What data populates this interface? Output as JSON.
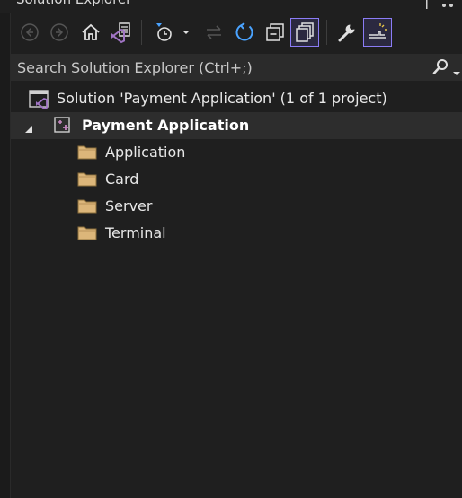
{
  "window": {
    "title": "Solution Explorer",
    "controls": [
      "pin-icon",
      "more-icon"
    ]
  },
  "toolbar": {
    "buttons": [
      {
        "name": "back-button",
        "icon": "back-arrow-icon",
        "enabled": false
      },
      {
        "name": "forward-button",
        "icon": "forward-arrow-icon",
        "enabled": false
      },
      {
        "name": "home-button",
        "icon": "home-icon",
        "enabled": true
      },
      {
        "name": "switch-views-button",
        "icon": "vs-solution-view-icon",
        "enabled": true
      },
      {
        "name": "pending-changes-filter-button",
        "icon": "clock-filter-icon",
        "enabled": true,
        "has_dropdown": true
      },
      {
        "name": "sync-with-active-document-button",
        "icon": "sync-arrows-icon",
        "enabled": false
      },
      {
        "name": "refresh-button",
        "icon": "refresh-icon",
        "enabled": true
      },
      {
        "name": "collapse-all-button",
        "icon": "collapse-all-icon",
        "enabled": true
      },
      {
        "name": "show-all-files-button",
        "icon": "show-all-files-icon",
        "enabled": true,
        "active": true
      },
      {
        "name": "properties-button",
        "icon": "wrench-icon",
        "enabled": true
      },
      {
        "name": "preview-selected-items-button",
        "icon": "preview-icon",
        "enabled": true,
        "active": true
      }
    ],
    "accent": "#8b7cf6"
  },
  "search": {
    "placeholder": "Search Solution Explorer (Ctrl+;)",
    "icon": "search-icon"
  },
  "tree": {
    "solution": {
      "label": "Solution 'Payment Application' (1 of 1 project)",
      "icon": "solution-icon"
    },
    "project": {
      "label": "Payment Application",
      "icon": "cpp-project-icon",
      "expanded": true,
      "selected": true
    },
    "folders": [
      {
        "label": "Application",
        "icon": "folder-icon"
      },
      {
        "label": "Card",
        "icon": "folder-icon"
      },
      {
        "label": "Server",
        "icon": "folder-icon"
      },
      {
        "label": "Terminal",
        "icon": "folder-icon"
      }
    ],
    "colors": {
      "folder": "#dcb67a",
      "vs_purple": "#a074c4"
    }
  }
}
